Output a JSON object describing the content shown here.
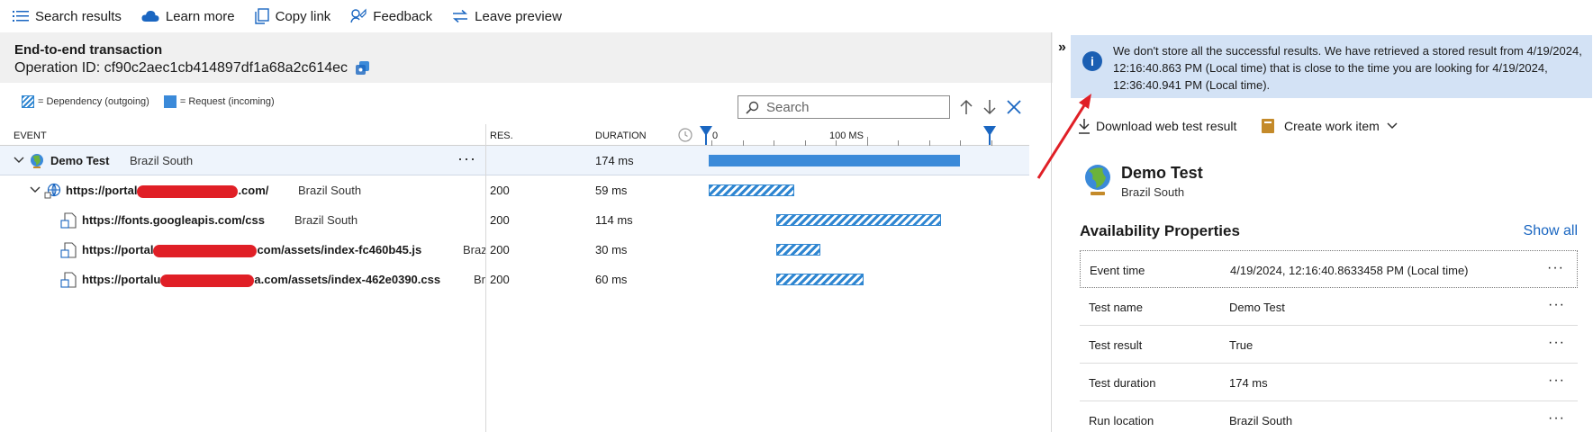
{
  "toolbar": {
    "search_results": "Search results",
    "learn_more": "Learn more",
    "copy_link": "Copy link",
    "feedback": "Feedback",
    "leave_preview": "Leave preview"
  },
  "header": {
    "title": "End-to-end transaction",
    "operation_id": "Operation ID: cf90c2aec1cb414897df1a68a2c614ec"
  },
  "legend": {
    "dependency": "= Dependency (outgoing)",
    "request": "= Request (incoming)"
  },
  "search": {
    "placeholder": "Search"
  },
  "grid": {
    "col_event": "EVENT",
    "col_res": "RES.",
    "col_duration": "DURATION",
    "axis_zero": "0",
    "axis_100": "100 MS",
    "rows": [
      {
        "name": "Demo Test",
        "region": "Brazil South",
        "res": "",
        "duration": "174 ms",
        "start": 0,
        "ms": 174,
        "kind": "request"
      },
      {
        "name_pre": "https://portal",
        "name_post": ".com/",
        "region": "Brazil South",
        "res": "200",
        "duration": "59 ms",
        "start": 0,
        "ms": 59,
        "kind": "dependency"
      },
      {
        "name": "https://fonts.googleapis.com/css",
        "region": "Brazil South",
        "res": "200",
        "duration": "114 ms",
        "start": 47,
        "ms": 114,
        "kind": "dependency"
      },
      {
        "name_pre": "https://portal",
        "name_post": "com/assets/index-fc460b45.js",
        "region": "Braz",
        "res": "200",
        "duration": "30 ms",
        "start": 47,
        "ms": 30,
        "kind": "dependency"
      },
      {
        "name_pre": "https://portalu",
        "name_post": "a.com/assets/index-462e0390.css",
        "region": "Br",
        "res": "200",
        "duration": "60 ms",
        "start": 47,
        "ms": 60,
        "kind": "dependency"
      }
    ]
  },
  "info": {
    "message": "We don't store all the successful results. We have retrieved a stored result from 4/19/2024, 12:16:40.863 PM (Local time) that is close to the time you are looking for 4/19/2024, 12:36:40.941 PM (Local time)."
  },
  "actions": {
    "download": "Download web test result",
    "create_work_item": "Create work item"
  },
  "detail": {
    "title": "Demo Test",
    "subtitle": "Brazil South",
    "section_title": "Availability Properties",
    "show_all": "Show all",
    "properties": [
      {
        "key": "Event time",
        "value": "4/19/2024, 12:16:40.8633458 PM (Local time)"
      },
      {
        "key": "Test name",
        "value": "Demo Test"
      },
      {
        "key": "Test result",
        "value": "True"
      },
      {
        "key": "Test duration",
        "value": "174 ms"
      },
      {
        "key": "Run location",
        "value": "Brazil South"
      }
    ]
  },
  "colors": {
    "accent": "#1a66c1",
    "bar": "#3b8ad9",
    "annotation_arrow": "#e01f26",
    "banner": "#d3e2f5"
  },
  "icons": [
    "list-icon",
    "cloud-icon",
    "copy-icon",
    "feedback-icon",
    "swap-icon",
    "copy-id-icon",
    "search-icon",
    "arrow-up-icon",
    "arrow-down-icon",
    "close-icon",
    "globe-icon",
    "dependency-icon",
    "info-icon",
    "download-icon",
    "work-item-icon",
    "chevron-down-icon",
    "more-icon"
  ]
}
